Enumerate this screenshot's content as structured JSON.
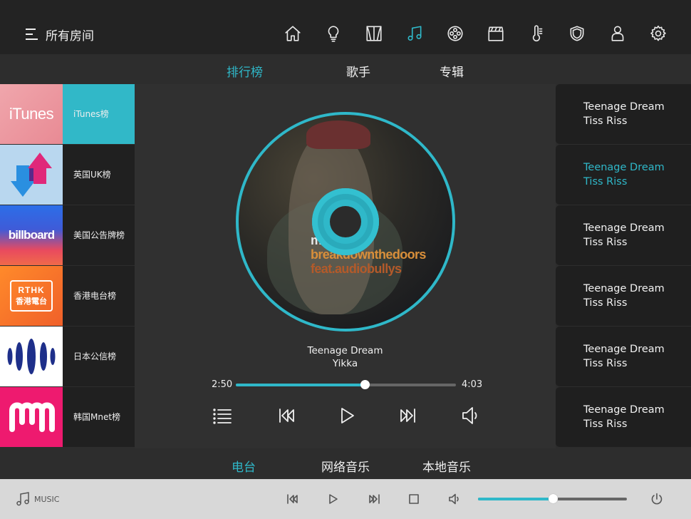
{
  "header": {
    "room_label": "所有房间",
    "icons": [
      "home-icon",
      "light-bulb-icon",
      "curtain-icon",
      "music-note-icon",
      "film-reel-icon",
      "clapperboard-icon",
      "thermometer-icon",
      "shield-icon",
      "person-icon",
      "gear-icon"
    ],
    "active_icon": "music-note-icon"
  },
  "category_tabs": [
    {
      "label": "排行榜",
      "active": true
    },
    {
      "label": "歌手",
      "active": false
    },
    {
      "label": "专辑",
      "active": false
    }
  ],
  "charts": [
    {
      "name": "iTunes榜",
      "logo_text": "iTunes",
      "active": true
    },
    {
      "name": "英国UK榜",
      "logo_text": "",
      "active": false
    },
    {
      "name": "美国公告牌榜",
      "logo_text": "billboard",
      "active": false
    },
    {
      "name": "香港电台榜",
      "logo_text": "RTHK 香港電台",
      "active": false
    },
    {
      "name": "日本公信榜",
      "logo_text": "",
      "active": false
    },
    {
      "name": "韩国Mnet榜",
      "logo_text": "M",
      "active": false
    }
  ],
  "now_playing": {
    "album_cover_text": [
      "m",
      "breakdownthedoors",
      "feat.audiobullys"
    ],
    "title": "Teenage Dream",
    "artist": "Yikka",
    "elapsed": "2:50",
    "duration": "4:03",
    "progress_fraction": 0.587
  },
  "songs": [
    {
      "title": "Teenage Dream",
      "artist": "Tiss Riss",
      "active": false
    },
    {
      "title": "Teenage Dream",
      "artist": "Tiss Riss",
      "active": true
    },
    {
      "title": "Teenage Dream",
      "artist": "Tiss Riss",
      "active": false
    },
    {
      "title": "Teenage Dream",
      "artist": "Tiss Riss",
      "active": false
    },
    {
      "title": "Teenage Dream",
      "artist": "Tiss Riss",
      "active": false
    },
    {
      "title": "Teenage Dream",
      "artist": "Tiss Riss",
      "active": false
    }
  ],
  "source_tabs": [
    {
      "label": "电台",
      "active": true
    },
    {
      "label": "网络音乐",
      "active": false
    },
    {
      "label": "本地音乐",
      "active": false
    }
  ],
  "bottom_bar": {
    "music_label": "MUSIC",
    "volume_fraction": 0.5
  },
  "colors": {
    "accent": "#2fb8c9",
    "background": "#2d2d2d",
    "bottom_bar": "#d8d8d8"
  }
}
